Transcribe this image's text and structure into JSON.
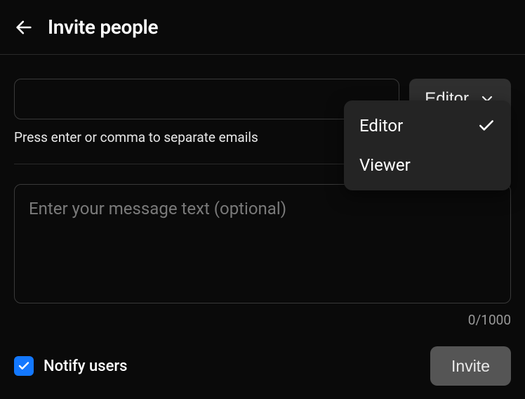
{
  "header": {
    "title": "Invite people"
  },
  "emails": {
    "value": "",
    "hint": "Press enter or comma to separate emails"
  },
  "role": {
    "selected": "Editor",
    "options": [
      {
        "label": "Editor",
        "selected": true
      },
      {
        "label": "Viewer",
        "selected": false
      }
    ]
  },
  "message": {
    "placeholder": "Enter your message text (optional)",
    "value": "",
    "counter": "0/1000"
  },
  "notify": {
    "label": "Notify users",
    "checked": true
  },
  "actions": {
    "invite": "Invite"
  },
  "colors": {
    "background": "#0a0a0a",
    "panel": "#242424",
    "accent": "#1378ff",
    "button_secondary": "#2f2f2f",
    "button_primary_disabled": "#555555"
  }
}
